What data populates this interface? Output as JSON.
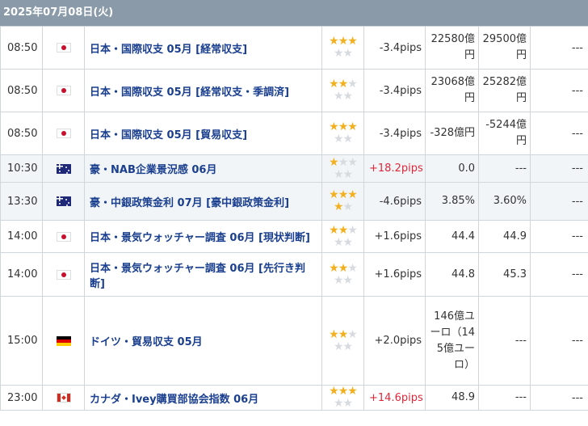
{
  "date": "2025年07月08日(火)",
  "rows": [
    {
      "time": "08:50",
      "country": "jp-flag-icon",
      "name": "日本・国際収支 05月 [経常収支]",
      "stars": [
        3,
        0
      ],
      "pips": "-3.4pips",
      "pips_pos": false,
      "prev": "22580億円",
      "forecast": "29500億円",
      "result": "---"
    },
    {
      "time": "08:50",
      "country": "jp-flag-icon",
      "name": "日本・国際収支 05月 [経常収支・季調済]",
      "stars": [
        2,
        0
      ],
      "pips": "-3.4pips",
      "pips_pos": false,
      "prev": "23068億円",
      "forecast": "25282億円",
      "result": "---"
    },
    {
      "time": "08:50",
      "country": "jp-flag-icon",
      "name": "日本・国際収支 05月 [貿易収支]",
      "stars": [
        3,
        0
      ],
      "pips": "-3.4pips",
      "pips_pos": false,
      "prev": "-328億円",
      "forecast": "-5244億円",
      "result": "---"
    },
    {
      "time": "10:30",
      "country": "au-flag-icon",
      "name": "豪・NAB企業景況感 06月",
      "stars": [
        1,
        0
      ],
      "pips": "+18.2pips",
      "pips_pos": true,
      "prev": "0.0",
      "forecast": "---",
      "result": "---"
    },
    {
      "time": "13:30",
      "country": "au-flag-icon",
      "name": "豪・中銀政策金利 07月 [豪中銀政策金利]",
      "stars": [
        3,
        1
      ],
      "pips": "-4.6pips",
      "pips_pos": false,
      "prev": "3.85%",
      "forecast": "3.60%",
      "result": "---"
    },
    {
      "time": "14:00",
      "country": "jp-flag-icon",
      "name": "日本・景気ウォッチャー調査 06月 [現状判断]",
      "stars": [
        2,
        0
      ],
      "pips": "+1.6pips",
      "pips_pos": false,
      "prev": "44.4",
      "forecast": "44.9",
      "result": "---"
    },
    {
      "time": "14:00",
      "country": "jp-flag-icon",
      "name": "日本・景気ウォッチャー調査 06月 [先行き判断]",
      "stars": [
        2,
        0
      ],
      "pips": "+1.6pips",
      "pips_pos": false,
      "prev": "44.8",
      "forecast": "45.3",
      "result": "---"
    },
    {
      "time": "15:00",
      "country": "de-flag-icon",
      "name": "ドイツ・貿易収支 05月",
      "stars": [
        2,
        0
      ],
      "pips": "+2.0pips",
      "pips_pos": false,
      "prev": "146億ユーロ（145億ユーロ）",
      "forecast": "---",
      "result": "---"
    },
    {
      "time": "23:00",
      "country": "ca-flag-icon",
      "name": "カナダ・Ivey購買部協会指数 06月",
      "stars": [
        3,
        0
      ],
      "pips": "+14.6pips",
      "pips_pos": true,
      "prev": "48.9",
      "forecast": "---",
      "result": "---"
    }
  ]
}
